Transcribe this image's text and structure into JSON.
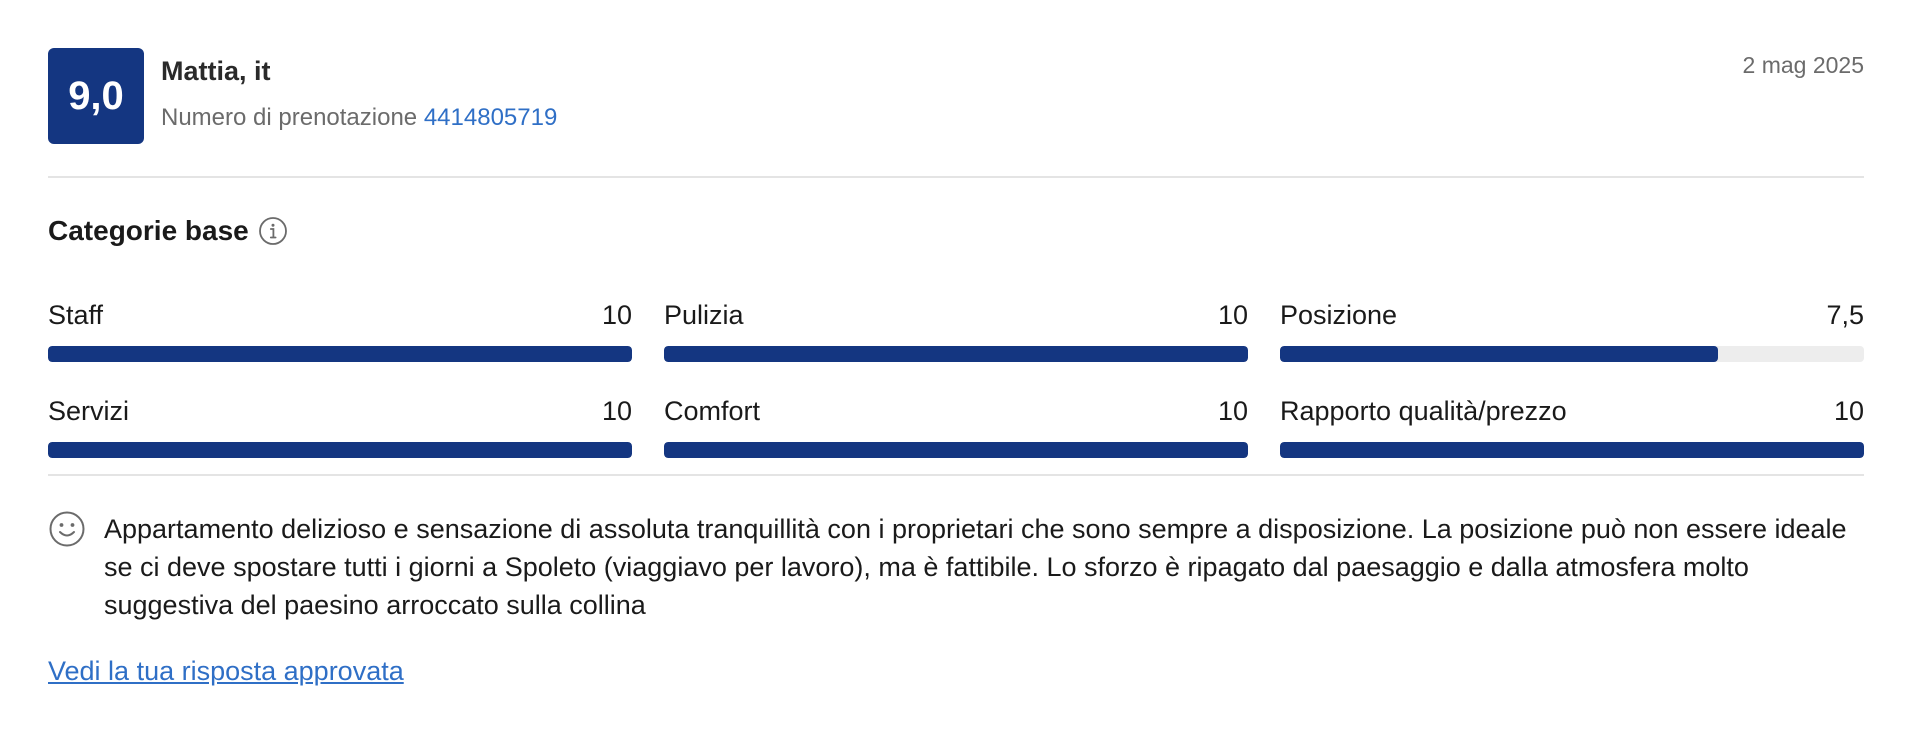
{
  "review": {
    "score": "9,0",
    "reviewer": "Mattia, it",
    "booking_label": "Numero di prenotazione",
    "booking_number": "4414805719",
    "date": "2 mag 2025"
  },
  "categories": {
    "title": "Categorie base",
    "info_icon": "info-icon",
    "items": [
      {
        "label": "Staff",
        "value": "10",
        "score": 10
      },
      {
        "label": "Pulizia",
        "value": "10",
        "score": 10
      },
      {
        "label": "Posizione",
        "value": "7,5",
        "score": 7.5
      },
      {
        "label": "Servizi",
        "value": "10",
        "score": 10
      },
      {
        "label": "Comfort",
        "value": "10",
        "score": 10
      },
      {
        "label": "Rapporto qualità/prezzo",
        "value": "10",
        "score": 10
      }
    ],
    "max_score": 10
  },
  "comment": {
    "icon": "smiley-icon",
    "text": "Appartamento delizioso e sensazione di assoluta tranquillità con i proprietari che sono sempre a disposizione. La posizione può non essere ideale se ci deve spostare tutti i giorni a Spoleto (viaggiavo per lavoro), ma è fattibile. Lo sforzo è ripagato dal paesaggio e dalla atmosfera molto suggestiva del paesino arroccato sulla collina"
  },
  "response_link": "Vedi la tua risposta approvata",
  "colors": {
    "brand": "#143681",
    "link": "#2f6fc6",
    "track": "#ededed",
    "muted_text": "#6b6b6b"
  }
}
